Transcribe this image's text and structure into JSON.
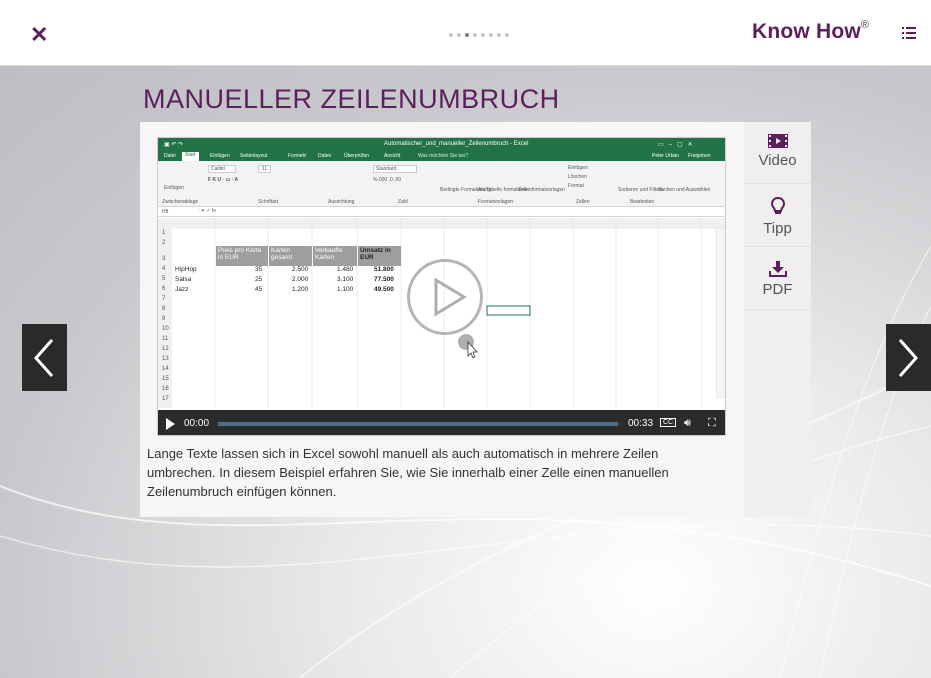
{
  "header": {
    "close_icon": "close-icon",
    "logo_text": "Know How",
    "logo_mark": "®",
    "dots_total": 8,
    "dots_active": 2,
    "menu_icon": "list-menu-icon"
  },
  "title": "MANUELLER ZEILENUMBRUCH",
  "side": {
    "video_label": "Video",
    "tip_label": "Tipp",
    "pdf_label": "PDF"
  },
  "video": {
    "excel_title": "Automatischer_und_manueller_Zeilenumbruch - Excel",
    "user": "Peter Urban",
    "share": "Freigeben",
    "search": "Was möchten Sie tun?",
    "tabs": [
      "Datei",
      "Start",
      "Einfügen",
      "Seitenlayout",
      "Formeln",
      "Daten",
      "Überprüfen",
      "Ansicht"
    ],
    "ribbon": {
      "font": "Calibri",
      "size": "11",
      "number_format": "Standard",
      "paste": "Einfügen",
      "clipboard": "Zwischenablage",
      "font_group": "Schriftart",
      "align": "Ausrichtung",
      "number": "Zahl",
      "styles": "Formatvorlagen",
      "cells": "Zellen",
      "edit": "Bearbeiten",
      "cond": "Bedingte Formatierung",
      "table": "Als Tabelle formatieren",
      "cellstyles": "Zellenformatvorlagen",
      "insert": "Einfügen",
      "delete": "Löschen",
      "format": "Format",
      "sort": "Sortieren und Filtern",
      "find": "Suchen und Auswählen"
    },
    "namebox": "H8",
    "columns": [
      "A",
      "B",
      "C",
      "D",
      "E",
      "F",
      "G",
      "H",
      "I",
      "J",
      "K",
      "L"
    ],
    "rows": [
      "1",
      "2",
      "3",
      "4",
      "5",
      "6",
      "7",
      "8",
      "9",
      "10",
      "11",
      "12",
      "13",
      "14",
      "15",
      "16",
      "17",
      "18"
    ],
    "headers": [
      "Preis pro Karte in EUR",
      "Karten gesamt",
      "Verkaufte Karten",
      "Umsatz in EUR"
    ],
    "data": [
      {
        "genre": "HipHop",
        "price": "35",
        "total": "2.500",
        "sold": "1.480",
        "revenue": "51.800"
      },
      {
        "genre": "Salsa",
        "price": "25",
        "total": "2.000",
        "sold": "3.100",
        "revenue": "77.500"
      },
      {
        "genre": "Jazz",
        "price": "45",
        "total": "1.200",
        "sold": "1.100",
        "revenue": "49.500"
      }
    ],
    "time_current": "00:00",
    "time_total": "00:33",
    "cc_label": "CC"
  },
  "description": "Lange Texte lassen sich in Excel sowohl manuell als auch automatisch in mehrere Zeilen umbrechen. In diesem Beispiel erfahren Sie, wie Sie innerhalb einer Zelle einen manuellen Zeilenumbruch einfügen können.",
  "colors": {
    "brand": "#5a1f5c",
    "excel_green": "#217346"
  }
}
